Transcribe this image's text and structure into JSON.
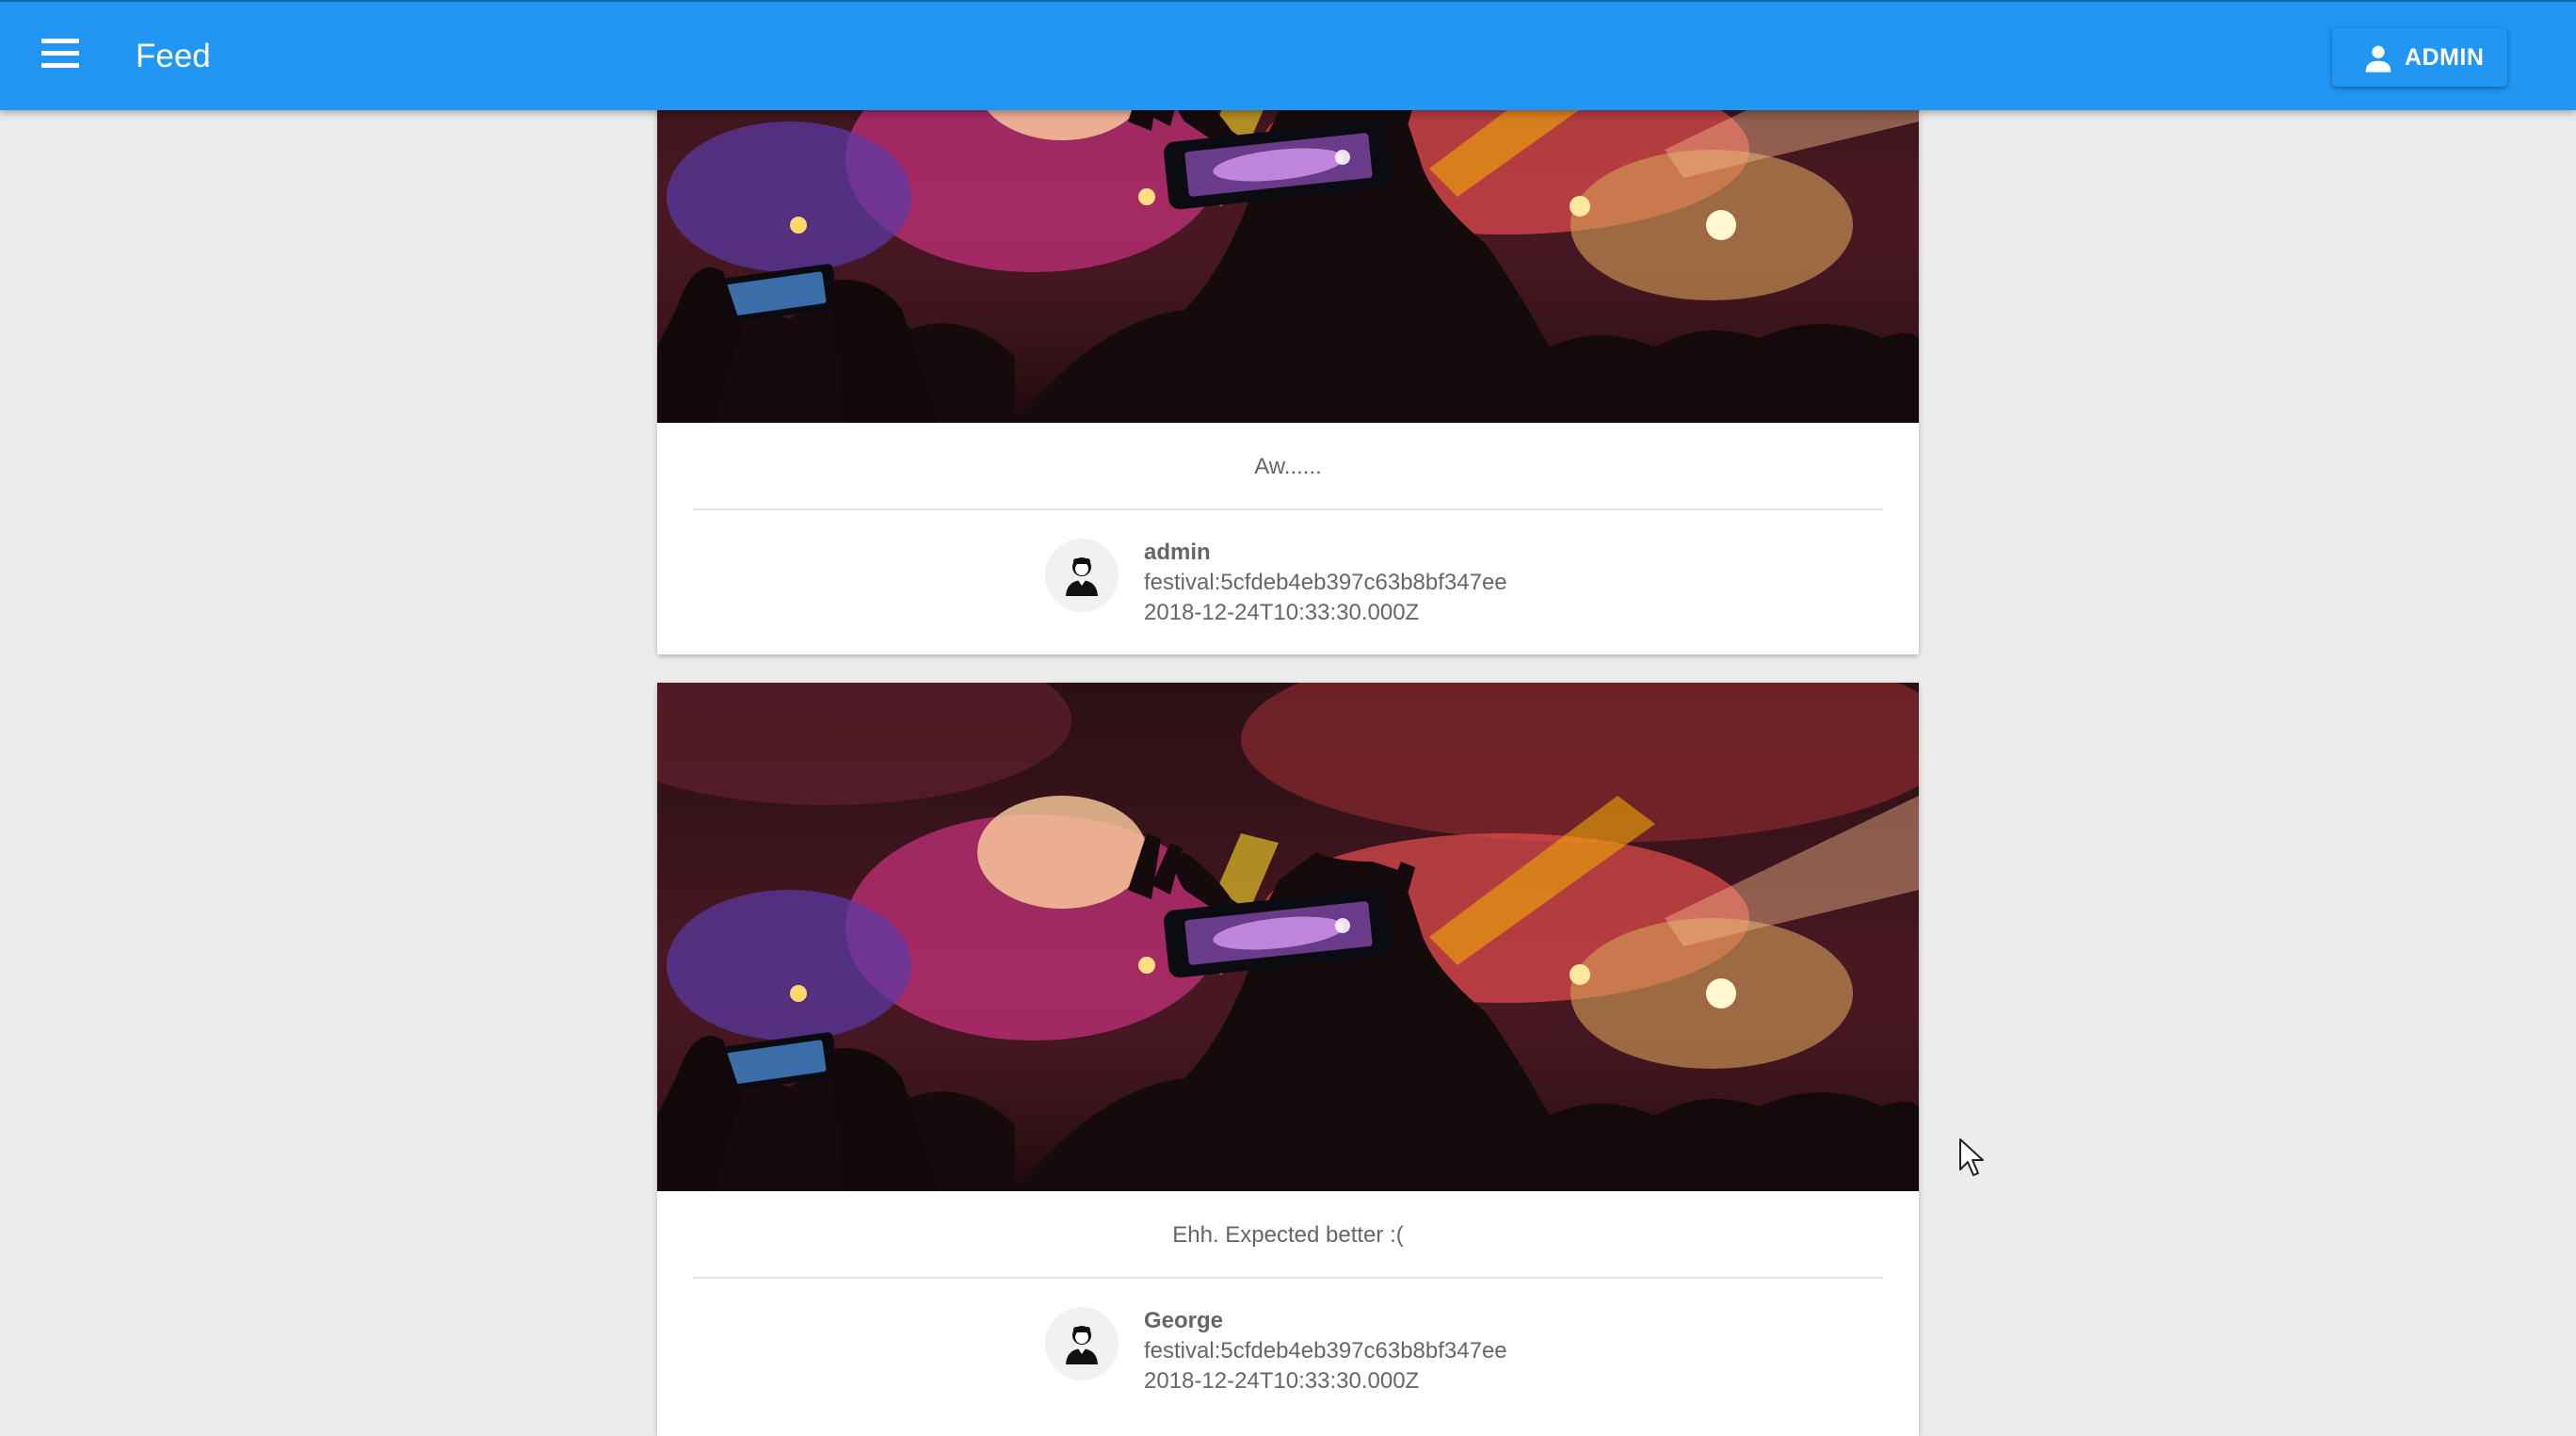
{
  "app": {
    "title": "Feed",
    "user_button_label": "ADMIN"
  },
  "posts": [
    {
      "comment": "Aw......",
      "author": "admin",
      "festival": "festival:5cfdeb4eb397c63b8bf347ee",
      "timestamp": "2018-12-24T10:33:30.000Z"
    },
    {
      "comment": "Ehh. Expected better :(",
      "author": "George",
      "festival": "festival:5cfdeb4eb397c63b8bf347ee",
      "timestamp": "2018-12-24T10:33:30.000Z"
    }
  ],
  "icons": {
    "menu": "menu-icon",
    "user": "person-icon",
    "avatar": "user-avatar-icon",
    "cursor": "mouse-pointer-icon"
  },
  "colors": {
    "appbar": "#2196f3",
    "background": "#ececec",
    "card": "#ffffff",
    "text": "#666666"
  }
}
